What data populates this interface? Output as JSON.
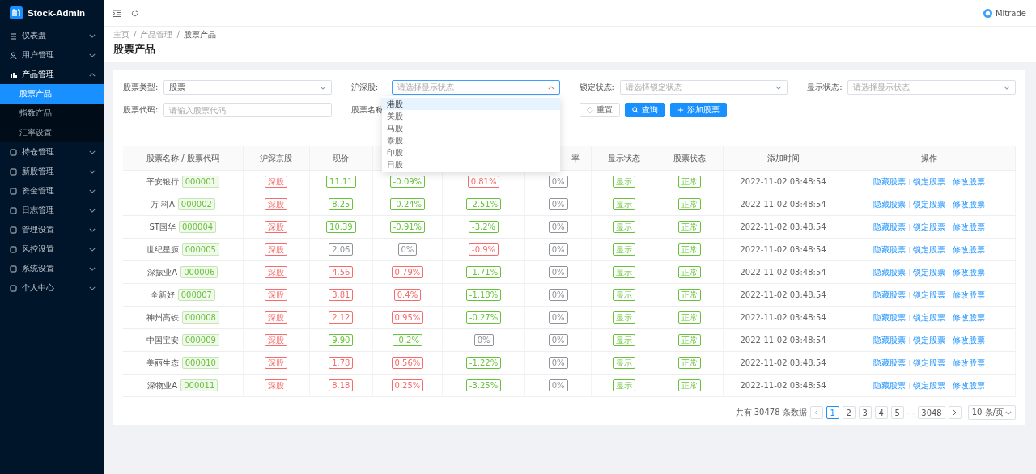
{
  "brand": {
    "name": "Stock-Admin"
  },
  "sidebar": {
    "items": [
      {
        "label": "仪表盘",
        "expanded": false
      },
      {
        "label": "用户管理",
        "expanded": false
      },
      {
        "label": "产品管理",
        "expanded": true,
        "children": [
          {
            "label": "股票产品",
            "selected": true
          },
          {
            "label": "指数产品",
            "selected": false
          },
          {
            "label": "汇率设置",
            "selected": false
          }
        ]
      },
      {
        "label": "持仓管理",
        "expanded": false
      },
      {
        "label": "新股管理",
        "expanded": false
      },
      {
        "label": "资金管理",
        "expanded": false
      },
      {
        "label": "日志管理",
        "expanded": false
      },
      {
        "label": "管理设置",
        "expanded": false
      },
      {
        "label": "风控设置",
        "expanded": false
      },
      {
        "label": "系统设置",
        "expanded": false
      },
      {
        "label": "个人中心",
        "expanded": false
      }
    ]
  },
  "header": {
    "user": "Mitrade"
  },
  "breadcrumb": {
    "separator": "/",
    "items": [
      "主页",
      "产品管理",
      "股票产品"
    ]
  },
  "page_title": "股票产品",
  "filters": [
    {
      "label": "股票类型:",
      "kind": "select",
      "value": "股票",
      "open": false
    },
    {
      "label": "沪深股:",
      "kind": "select",
      "placeholder": "请选择显示状态",
      "open": true
    },
    {
      "label": "锁定状态:",
      "kind": "select",
      "placeholder": "请选择锁定状态",
      "open": false
    },
    {
      "label": "显示状态:",
      "kind": "select",
      "placeholder": "请选择显示状态",
      "open": false
    },
    {
      "label": "股票代码:",
      "kind": "input",
      "placeholder": "请输入股票代码"
    },
    {
      "label": "股票名称",
      "kind": "covered"
    }
  ],
  "dropdown": {
    "options": [
      {
        "label": "港股",
        "selected": true
      },
      {
        "label": "美股",
        "selected": false
      },
      {
        "label": "马股",
        "selected": false
      },
      {
        "label": "泰股",
        "selected": false
      },
      {
        "label": "印股",
        "selected": false
      },
      {
        "label": "日股",
        "selected": false
      }
    ]
  },
  "buttons": [
    {
      "label": "重置",
      "kind": "reset"
    },
    {
      "label": "查询",
      "kind": "search"
    },
    {
      "label": "添加股票",
      "kind": "add"
    }
  ],
  "table": {
    "columns": [
      {
        "label": "股票名称 / 股票代码"
      },
      {
        "label": "沪深京股"
      },
      {
        "label": "现价"
      },
      {},
      {},
      {
        "label": "率"
      },
      {
        "label": "显示状态"
      },
      {
        "label": "股票状态"
      },
      {
        "label": "添加时间"
      },
      {
        "label": "操作"
      }
    ],
    "rows": [
      {
        "name": "平安银行",
        "code": "000001",
        "market": {
          "text": "深股",
          "color": "#f56c6c"
        },
        "price": {
          "text": "11.11",
          "color": "#67c23a"
        },
        "col4": {
          "text": "-0.09%",
          "color": "#67c23a"
        },
        "col5": {
          "text": "0.81%",
          "color": "#f56c6c"
        },
        "col6": {
          "text": "0%",
          "color": "#909399"
        },
        "display": {
          "text": "显示",
          "color": "#67c23a"
        },
        "status": {
          "text": "正常",
          "color": "#67c23a"
        },
        "time": "2022-11-02 03:48:54",
        "actions": [
          "隐藏股票",
          "锁定股票",
          "修改股票"
        ]
      },
      {
        "name": "万 科A",
        "code": "000002",
        "market": {
          "text": "深股",
          "color": "#f56c6c"
        },
        "price": {
          "text": "8.25",
          "color": "#67c23a"
        },
        "col4": {
          "text": "-0.24%",
          "color": "#67c23a"
        },
        "col5": {
          "text": "-2.51%",
          "color": "#67c23a"
        },
        "col6": {
          "text": "0%",
          "color": "#909399"
        },
        "display": {
          "text": "显示",
          "color": "#67c23a"
        },
        "status": {
          "text": "正常",
          "color": "#67c23a"
        },
        "time": "2022-11-02 03:48:54",
        "actions": [
          "隐藏股票",
          "锁定股票",
          "修改股票"
        ]
      },
      {
        "name": "ST国华",
        "code": "000004",
        "market": {
          "text": "深股",
          "color": "#f56c6c"
        },
        "price": {
          "text": "10.39",
          "color": "#67c23a"
        },
        "col4": {
          "text": "-0.91%",
          "color": "#67c23a"
        },
        "col5": {
          "text": "-3.2%",
          "color": "#67c23a"
        },
        "col6": {
          "text": "0%",
          "color": "#909399"
        },
        "display": {
          "text": "显示",
          "color": "#67c23a"
        },
        "status": {
          "text": "正常",
          "color": "#67c23a"
        },
        "time": "2022-11-02 03:48:54",
        "actions": [
          "隐藏股票",
          "锁定股票",
          "修改股票"
        ]
      },
      {
        "name": "世纪星源",
        "code": "000005",
        "market": {
          "text": "深股",
          "color": "#f56c6c"
        },
        "price": {
          "text": "2.06",
          "color": "#909399"
        },
        "col4": {
          "text": "0%",
          "color": "#909399"
        },
        "col5": {
          "text": "-0.9%",
          "color": "#f56c6c"
        },
        "col6": {
          "text": "0%",
          "color": "#909399"
        },
        "display": {
          "text": "显示",
          "color": "#67c23a"
        },
        "status": {
          "text": "正常",
          "color": "#67c23a"
        },
        "time": "2022-11-02 03:48:54",
        "actions": [
          "隐藏股票",
          "锁定股票",
          "修改股票"
        ]
      },
      {
        "name": "深振业A",
        "code": "000006",
        "market": {
          "text": "深股",
          "color": "#f56c6c"
        },
        "price": {
          "text": "4.56",
          "color": "#f56c6c"
        },
        "col4": {
          "text": "0.79%",
          "color": "#f56c6c"
        },
        "col5": {
          "text": "-1.71%",
          "color": "#67c23a"
        },
        "col6": {
          "text": "0%",
          "color": "#909399"
        },
        "display": {
          "text": "显示",
          "color": "#67c23a"
        },
        "status": {
          "text": "正常",
          "color": "#67c23a"
        },
        "time": "2022-11-02 03:48:54",
        "actions": [
          "隐藏股票",
          "锁定股票",
          "修改股票"
        ]
      },
      {
        "name": "全新好",
        "code": "000007",
        "market": {
          "text": "深股",
          "color": "#f56c6c"
        },
        "price": {
          "text": "3.81",
          "color": "#f56c6c"
        },
        "col4": {
          "text": "0.4%",
          "color": "#f56c6c"
        },
        "col5": {
          "text": "-1.18%",
          "color": "#67c23a"
        },
        "col6": {
          "text": "0%",
          "color": "#909399"
        },
        "display": {
          "text": "显示",
          "color": "#67c23a"
        },
        "status": {
          "text": "正常",
          "color": "#67c23a"
        },
        "time": "2022-11-02 03:48:54",
        "actions": [
          "隐藏股票",
          "锁定股票",
          "修改股票"
        ]
      },
      {
        "name": "神州高铁",
        "code": "000008",
        "market": {
          "text": "深股",
          "color": "#f56c6c"
        },
        "price": {
          "text": "2.12",
          "color": "#f56c6c"
        },
        "col4": {
          "text": "0.95%",
          "color": "#f56c6c"
        },
        "col5": {
          "text": "-0.27%",
          "color": "#67c23a"
        },
        "col6": {
          "text": "0%",
          "color": "#909399"
        },
        "display": {
          "text": "显示",
          "color": "#67c23a"
        },
        "status": {
          "text": "正常",
          "color": "#67c23a"
        },
        "time": "2022-11-02 03:48:54",
        "actions": [
          "隐藏股票",
          "锁定股票",
          "修改股票"
        ]
      },
      {
        "name": "中国宝安",
        "code": "000009",
        "market": {
          "text": "深股",
          "color": "#f56c6c"
        },
        "price": {
          "text": "9.90",
          "color": "#67c23a"
        },
        "col4": {
          "text": "-0.2%",
          "color": "#67c23a"
        },
        "col5": {
          "text": "0%",
          "color": "#909399"
        },
        "col6": {
          "text": "0%",
          "color": "#909399"
        },
        "display": {
          "text": "显示",
          "color": "#67c23a"
        },
        "status": {
          "text": "正常",
          "color": "#67c23a"
        },
        "time": "2022-11-02 03:48:54",
        "actions": [
          "隐藏股票",
          "锁定股票",
          "修改股票"
        ]
      },
      {
        "name": "美丽生态",
        "code": "000010",
        "market": {
          "text": "深股",
          "color": "#f56c6c"
        },
        "price": {
          "text": "1.78",
          "color": "#f56c6c"
        },
        "col4": {
          "text": "0.56%",
          "color": "#f56c6c"
        },
        "col5": {
          "text": "-1.22%",
          "color": "#67c23a"
        },
        "col6": {
          "text": "0%",
          "color": "#909399"
        },
        "display": {
          "text": "显示",
          "color": "#67c23a"
        },
        "status": {
          "text": "正常",
          "color": "#67c23a"
        },
        "time": "2022-11-02 03:48:54",
        "actions": [
          "隐藏股票",
          "锁定股票",
          "修改股票"
        ]
      },
      {
        "name": "深物业A",
        "code": "000011",
        "market": {
          "text": "深股",
          "color": "#f56c6c"
        },
        "price": {
          "text": "8.18",
          "color": "#f56c6c"
        },
        "col4": {
          "text": "0.25%",
          "color": "#f56c6c"
        },
        "col5": {
          "text": "-3.25%",
          "color": "#67c23a"
        },
        "col6": {
          "text": "0%",
          "color": "#909399"
        },
        "display": {
          "text": "显示",
          "color": "#67c23a"
        },
        "status": {
          "text": "正常",
          "color": "#67c23a"
        },
        "time": "2022-11-02 03:48:54",
        "actions": [
          "隐藏股票",
          "锁定股票",
          "修改股票"
        ]
      }
    ]
  },
  "pagination": {
    "total": "共有 30478 条数据",
    "pages": [
      {
        "label": "1",
        "selected": true
      },
      {
        "label": "2",
        "selected": false
      },
      {
        "label": "3",
        "selected": false
      },
      {
        "label": "4",
        "selected": false
      },
      {
        "label": "5",
        "selected": false
      }
    ],
    "ellipsis": "···",
    "last": "3048",
    "page_size": "10 条/页"
  }
}
